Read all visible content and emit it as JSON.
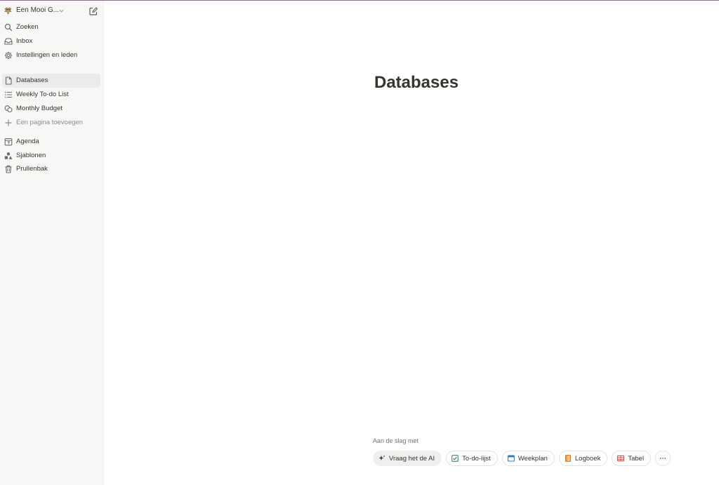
{
  "workspace": {
    "name": "Een Mooi G...",
    "avatar_icon": "owl-icon"
  },
  "sidebar": {
    "top_items": [
      {
        "label": "Zoeken",
        "icon": "search-icon"
      },
      {
        "label": "Inbox",
        "icon": "inbox-icon"
      },
      {
        "label": "Instellingen en leden",
        "icon": "gear-icon"
      }
    ],
    "pages": [
      {
        "label": "Databases",
        "icon": "page-icon",
        "active": true
      },
      {
        "label": "Weekly To-do List",
        "icon": "list-icon"
      },
      {
        "label": "Monthly Budget",
        "icon": "coins-icon"
      },
      {
        "label": "Een pagina toevoegen",
        "icon": "plus-icon"
      }
    ],
    "bottom_items": [
      {
        "label": "Agenda",
        "icon": "calendar-icon"
      },
      {
        "label": "Sjablonen",
        "icon": "shapes-icon"
      },
      {
        "label": "Prullenbak",
        "icon": "trash-icon"
      }
    ]
  },
  "page": {
    "title": "Databases"
  },
  "getting_started": {
    "label": "Aan de slag met",
    "chips": [
      {
        "label": "Vraag het de AI",
        "icon": "sparkle-icon"
      },
      {
        "label": "To-do-lijst",
        "icon": "checkbox-icon",
        "color": "#448361"
      },
      {
        "label": "Weekplan",
        "icon": "calendar-window-icon",
        "color": "#2f7bb8"
      },
      {
        "label": "Logboek",
        "icon": "book-icon",
        "color": "#d9730d"
      },
      {
        "label": "Tabel",
        "icon": "table-icon",
        "color": "#d44c47"
      }
    ],
    "more_icon": "ellipsis-icon"
  },
  "colors": {
    "sidebar_bg": "#f7f7f5",
    "text": "#37352f",
    "muted": "#8e8c88",
    "top_border": "#8a6e8e"
  }
}
